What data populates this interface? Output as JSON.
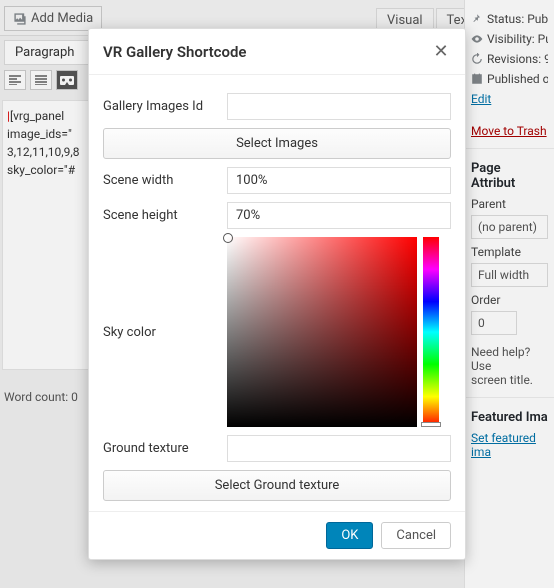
{
  "toolbar": {
    "add_media": "Add Media",
    "tab_visual": "Visual",
    "tab_text": "Text",
    "format_para": "Paragraph"
  },
  "editor": {
    "line1": "[vrg_panel",
    "line2": "image_ids=\"",
    "line3": "3,12,11,10,9,8",
    "line4": "sky_color=\"#",
    "word_count": "Word count: 0"
  },
  "side": {
    "status": "Status: Publ",
    "visibility": "Visibility: Pu",
    "revisions": "Revisions: 9",
    "published": "Published o",
    "edit": "Edit",
    "trash": "Move to Trash",
    "page_attr": "Page Attribut",
    "parent_label": "Parent",
    "parent_value": "(no parent)",
    "template_label": "Template",
    "template_value": "Full width",
    "order_label": "Order",
    "order_value": "0",
    "help": "Need help? Use",
    "help2": "screen title.",
    "featured": "Featured Ima",
    "set_featured": "Set featured ima"
  },
  "modal": {
    "title": "VR Gallery Shortcode",
    "gallery_ids_label": "Gallery Images Id",
    "gallery_ids_value": "",
    "select_images_btn": "Select Images",
    "scene_w_label": "Scene width",
    "scene_w_value": "100%",
    "scene_h_label": "Scene height",
    "scene_h_value": "70%",
    "sky_color_label": "Sky color",
    "ground_label": "Ground texture",
    "ground_value": "",
    "select_ground_btn": "Select Ground texture",
    "ok": "OK",
    "cancel": "Cancel"
  }
}
